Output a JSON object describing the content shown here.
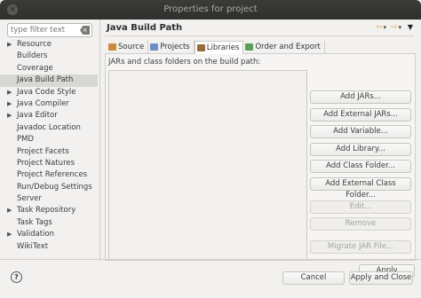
{
  "window": {
    "title": "Properties for project"
  },
  "filter": {
    "placeholder": "type filter text"
  },
  "tree": [
    {
      "label": "Resource",
      "expandable": true
    },
    {
      "label": "Builders",
      "expandable": false
    },
    {
      "label": "Coverage",
      "expandable": false
    },
    {
      "label": "Java Build Path",
      "expandable": false,
      "selected": true
    },
    {
      "label": "Java Code Style",
      "expandable": true
    },
    {
      "label": "Java Compiler",
      "expandable": true
    },
    {
      "label": "Java Editor",
      "expandable": true
    },
    {
      "label": "Javadoc Location",
      "expandable": false
    },
    {
      "label": "PMD",
      "expandable": false
    },
    {
      "label": "Project Facets",
      "expandable": false
    },
    {
      "label": "Project Natures",
      "expandable": false
    },
    {
      "label": "Project References",
      "expandable": false
    },
    {
      "label": "Run/Debug Settings",
      "expandable": false
    },
    {
      "label": "Server",
      "expandable": false
    },
    {
      "label": "Task Repository",
      "expandable": true
    },
    {
      "label": "Task Tags",
      "expandable": false
    },
    {
      "label": "Validation",
      "expandable": true
    },
    {
      "label": "WikiText",
      "expandable": false
    }
  ],
  "page": {
    "title": "Java Build Path"
  },
  "tabs": [
    {
      "label": "Source",
      "icon": "source-icon",
      "color": "#c98a3a"
    },
    {
      "label": "Projects",
      "icon": "projects-icon",
      "color": "#6b8fc7"
    },
    {
      "label": "Libraries",
      "icon": "libraries-icon",
      "color": "#9a6a3a",
      "active": true
    },
    {
      "label": "Order and Export",
      "icon": "order-icon",
      "color": "#5a9e5a"
    }
  ],
  "libraries": {
    "list_label": "JARs and class folders on the build path:",
    "buttons": [
      {
        "label": "Add JARs...",
        "enabled": true
      },
      {
        "label": "Add External JARs...",
        "enabled": true
      },
      {
        "label": "Add Variable...",
        "enabled": true
      },
      {
        "label": "Add Library...",
        "enabled": true
      },
      {
        "label": "Add Class Folder...",
        "enabled": true
      },
      {
        "label": "Add External Class Folder...",
        "enabled": true
      },
      {
        "label": "Edit...",
        "enabled": false
      },
      {
        "label": "Remove",
        "enabled": false
      },
      {
        "label": "Migrate JAR File...",
        "enabled": false
      }
    ]
  },
  "footer": {
    "apply": "Apply",
    "cancel": "Cancel",
    "apply_and_close": "Apply and Close"
  },
  "glyphs": {
    "close": "×",
    "help": "?",
    "tree_arrow": "▶",
    "clear": "×"
  }
}
